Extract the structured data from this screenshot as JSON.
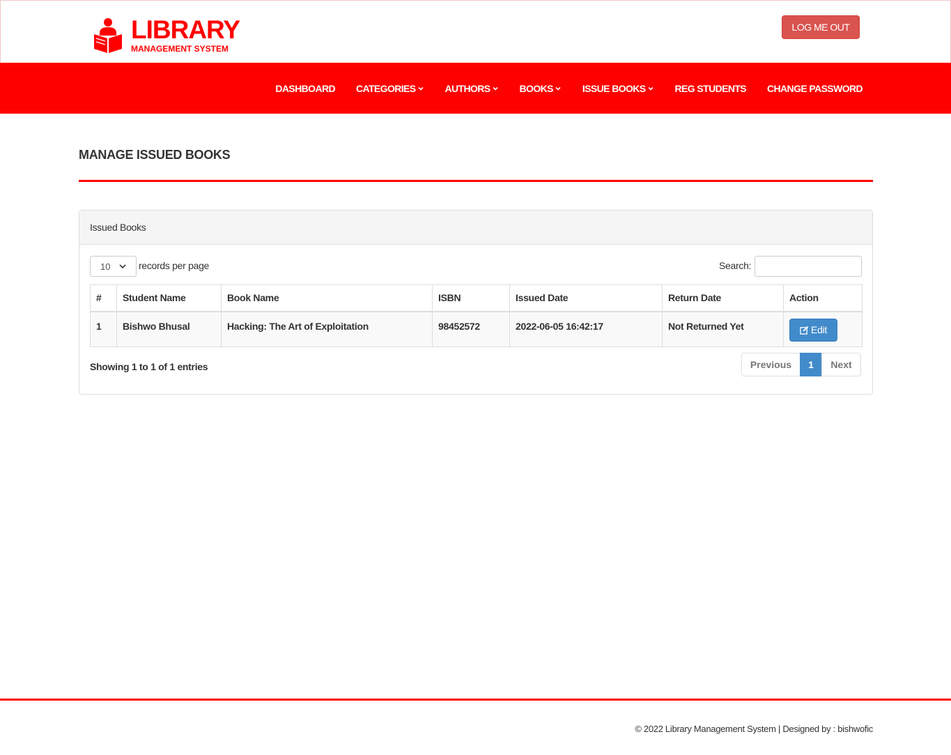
{
  "brand": {
    "title": "LIBRARY",
    "subtitle": "MANAGEMENT SYSTEM",
    "color": "#ff0000"
  },
  "header": {
    "logout_label": "LOG ME OUT"
  },
  "nav": {
    "items": [
      {
        "label": "DASHBOARD",
        "dropdown": false
      },
      {
        "label": "CATEGORIES",
        "dropdown": true
      },
      {
        "label": "AUTHORS",
        "dropdown": true
      },
      {
        "label": "BOOKS",
        "dropdown": true
      },
      {
        "label": "ISSUE BOOKS",
        "dropdown": true
      },
      {
        "label": "REG STUDENTS",
        "dropdown": false
      },
      {
        "label": "CHANGE PASSWORD",
        "dropdown": false
      }
    ]
  },
  "page": {
    "title": "MANAGE ISSUED BOOKS"
  },
  "panel": {
    "heading": "Issued Books",
    "length_value": "10",
    "length_label": "records per page",
    "search_label": "Search:",
    "search_value": "",
    "columns": [
      "#",
      "Student Name",
      "Book Name",
      "ISBN",
      "Issued Date",
      "Return Date",
      "Action"
    ],
    "rows": [
      {
        "num": "1",
        "student": "Bishwo Bhusal",
        "book": "Hacking: The Art of Exploitation",
        "isbn": "98452572",
        "issued": "2022-06-05 16:42:17",
        "returned": "Not Returned Yet",
        "action": "Edit"
      }
    ],
    "info": "Showing 1 to 1 of 1 entries",
    "pager": {
      "prev": "Previous",
      "current": "1",
      "next": "Next"
    }
  },
  "footer": {
    "text": "© 2022 Library Management System | Designed by : bishwofic"
  }
}
